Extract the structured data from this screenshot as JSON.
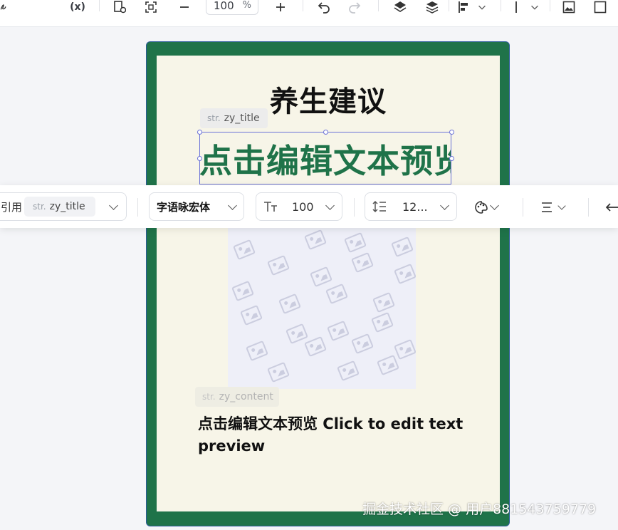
{
  "toolbar": {
    "variable_label": "(x)",
    "zoom_value": "100",
    "zoom_unit": "%",
    "icons": [
      "curly-icon",
      "variable-icon",
      "add-frame-icon",
      "fit-icon",
      "zoom-out-icon",
      "zoom-in-icon",
      "undo-icon",
      "redo-icon",
      "layer-up-icon",
      "layer-stack-icon",
      "align-icon",
      "chevron-down-icon",
      "line-icon",
      "chevron-down-icon",
      "image-icon",
      "frame-icon"
    ]
  },
  "canvas": {
    "heading": "养生建议",
    "title_chip": {
      "prefix": "str.",
      "name": "zy_title"
    },
    "title_text": "点击编辑文本预览",
    "content_chip": {
      "prefix": "str.",
      "name": "zy_content"
    },
    "content_text": "点击编辑文本预览 Click to edit text preview",
    "colors": {
      "frame": "#1f7349",
      "background": "#f7f5e8",
      "title": "#1f7349",
      "selection": "#6b72d8"
    }
  },
  "text_toolbar": {
    "reference_label": "引用",
    "reference_chip": {
      "prefix": "str.",
      "name": "zy_title"
    },
    "font_family": "字语咏宏体",
    "font_size": "100",
    "line_height": "12..."
  },
  "watermark": "掘金技术社区 @ 用户881543759779"
}
